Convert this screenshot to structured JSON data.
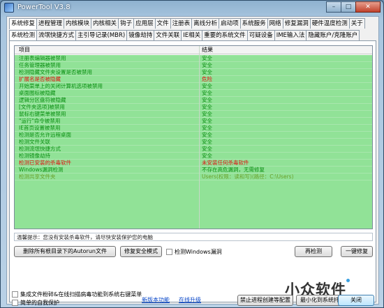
{
  "window": {
    "title": "PowerTool V3.8"
  },
  "main_tabs": [
    "系统修复",
    "进程管理",
    "内核模块",
    "内核相关",
    "钩子",
    "应用层",
    "文件",
    "注册表",
    "离线分析",
    "启动项",
    "系统服务",
    "网络",
    "修复漏洞",
    "硬件温度检测",
    "关于"
  ],
  "sub_tabs": [
    "系统检测",
    "流氓快捷方式",
    "主引导记录(MBR)",
    "镜像劫持",
    "文件关联",
    "IE相关",
    "重要的系统文件",
    "可疑设备",
    "IME输入法",
    "隐藏账户/克隆账户"
  ],
  "table": {
    "headers": [
      "项目",
      "结果"
    ],
    "rows": [
      {
        "item": "注册表编辑器被禁用",
        "result": "安全",
        "color": "#0a8f12"
      },
      {
        "item": "任务管理器被禁用",
        "result": "安全",
        "color": "#0a8f12"
      },
      {
        "item": "检测隐藏文件夹设置是否被禁用",
        "result": "安全",
        "color": "#0a8f12"
      },
      {
        "item": "扩展名是否被隐藏",
        "result": "危险",
        "color": "#e01010"
      },
      {
        "item": "开始菜单上的关闭计算机选项被禁用",
        "result": "安全",
        "color": "#0a8f12"
      },
      {
        "item": "桌面图标被隐藏",
        "result": "安全",
        "color": "#0a8f12"
      },
      {
        "item": "逻辑分区盘符被隐藏",
        "result": "安全",
        "color": "#0a8f12"
      },
      {
        "item": "[文件夹选项]被禁用",
        "result": "安全",
        "color": "#0a8f12"
      },
      {
        "item": "鼠标右键菜单被禁用",
        "result": "安全",
        "color": "#0a8f12"
      },
      {
        "item": "\"运行\"命令被禁用",
        "result": "安全",
        "color": "#0a8f12"
      },
      {
        "item": "IE首页设置被禁用",
        "result": "安全",
        "color": "#0a8f12"
      },
      {
        "item": "检测是否允许远程桌面",
        "result": "安全",
        "color": "#0a8f12"
      },
      {
        "item": "检测文件关联",
        "result": "安全",
        "color": "#0a8f12"
      },
      {
        "item": "检测流氓快捷方式",
        "result": "安全",
        "color": "#0a8f12"
      },
      {
        "item": "检测镜像劫持",
        "result": "安全",
        "color": "#0a8f12"
      },
      {
        "item": "检测已安装的杀毒软件",
        "result": "未安装任何杀毒软件",
        "color": "#e01010"
      },
      {
        "item": "Windows漏洞检测",
        "result": "不存在高危漏洞，无需修复",
        "color": "#0a8f12"
      },
      {
        "item": "检测共享文件夹",
        "result": "Users(权限：读和写)(路径：C:\\Users)",
        "color": "#6aa02a"
      }
    ]
  },
  "hint": "温馨提示：您没有安装杀毒软件，请尽快安装保护您的电脑",
  "buttons": {
    "delete_autorun": "删除所有根目录下的Autorun文件",
    "repair_safemode": "修复安全模式",
    "recheck": "再检测",
    "one_click_repair": "一键修复",
    "forbid_process": "禁止进程创建等配置",
    "minimize_tray": "最小化到系统托盘",
    "close": "关闭"
  },
  "checkboxes": {
    "check_windows_vuln": "检测Windows漏洞",
    "integrate_shell": "集成文件粉碎&在线扫描病毒功能到系统右键菜单",
    "self_protect": "简单的自我保护"
  },
  "links": {
    "new_version": "新版本功能",
    "online_upgrade": "在线升级"
  },
  "watermark": "小众软件"
}
